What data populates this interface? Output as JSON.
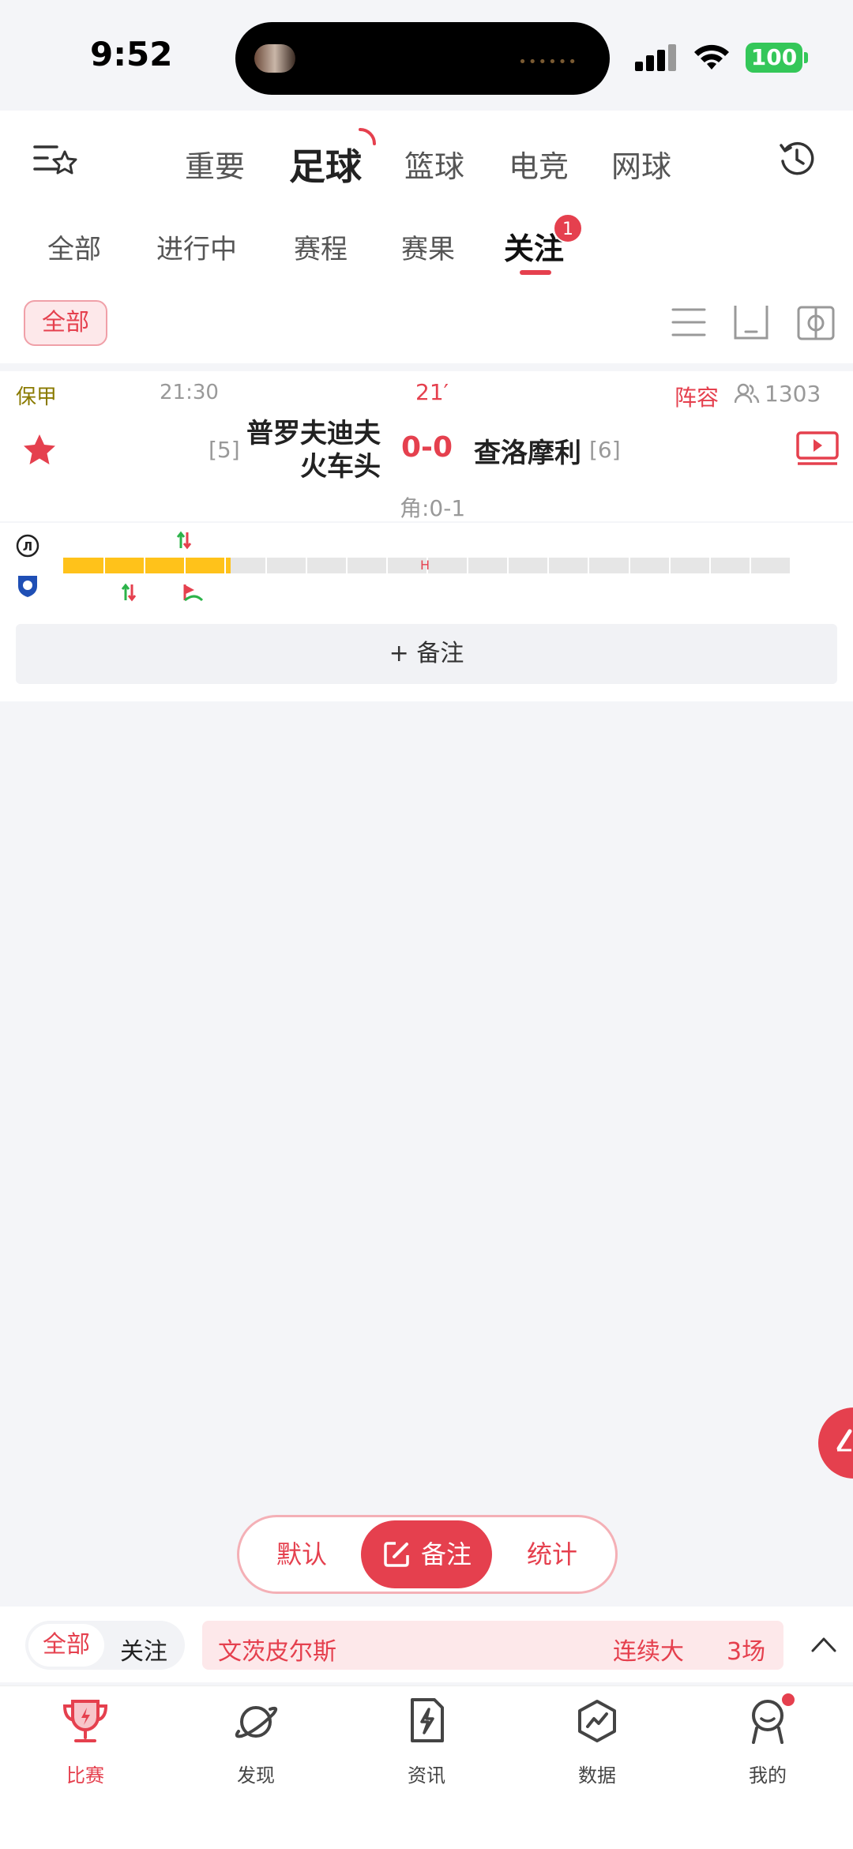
{
  "status": {
    "time": "9:52",
    "battery": "100"
  },
  "sport_tabs": [
    "重要",
    "足球",
    "篮球",
    "电竞",
    "网球"
  ],
  "sub_tabs": [
    "全部",
    "进行中",
    "赛程",
    "赛果",
    "关注"
  ],
  "follow_badge": "1",
  "filter": {
    "all": "全部"
  },
  "match": {
    "league": "保甲",
    "kickoff": "21:30",
    "minute": "21",
    "minute_mark": "′",
    "lineup": "阵容",
    "viewers": "1303",
    "home_rank": "[5]",
    "home_name": "普罗夫迪夫火车头",
    "score": "0-0",
    "away_name": "查洛摩利",
    "away_rank": "[6]",
    "corners": "角:0-1",
    "half_marker": "H",
    "progress_fraction": 0.23
  },
  "note_button": "+ 备注",
  "segment": {
    "default": "默认",
    "note": "备注",
    "stats": "统计"
  },
  "ticker": {
    "all": "全部",
    "follow": "关注",
    "team": "文茨皮尔斯",
    "trend": "连续大",
    "count": "3场"
  },
  "tabbar": [
    {
      "label": "比赛",
      "icon": "trophy-icon"
    },
    {
      "label": "发现",
      "icon": "planet-icon"
    },
    {
      "label": "资讯",
      "icon": "news-icon"
    },
    {
      "label": "数据",
      "icon": "data-icon"
    },
    {
      "label": "我的",
      "icon": "profile-icon"
    }
  ],
  "colors": {
    "accent": "#e5404e",
    "progress": "#ffc21a"
  }
}
